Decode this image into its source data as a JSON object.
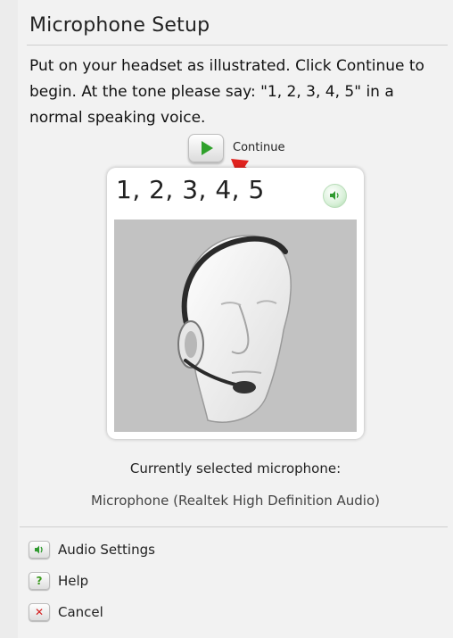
{
  "dialog": {
    "title": "Microphone Setup",
    "instructions": "Put on your headset as illustrated. Click Continue to begin. At the tone please say: \"1, 2, 3, 4, 5\" in a normal speaking voice.",
    "continue_label": "Continue",
    "phrase": "1, 2, 3, 4, 5",
    "selected_mic_label": "Currently selected microphone:",
    "selected_mic_name": "Microphone (Realtek High Definition Audio)"
  },
  "links": [
    {
      "label": "Audio Settings",
      "icon": "speaker-icon"
    },
    {
      "label": "Help",
      "icon": "question-icon"
    },
    {
      "label": "Cancel",
      "icon": "x-icon"
    }
  ],
  "colors": {
    "play_green": "#2fa12b",
    "annotation_red": "#e0221e",
    "cancel_red": "#d42020",
    "help_green": "#3c9a1e"
  }
}
